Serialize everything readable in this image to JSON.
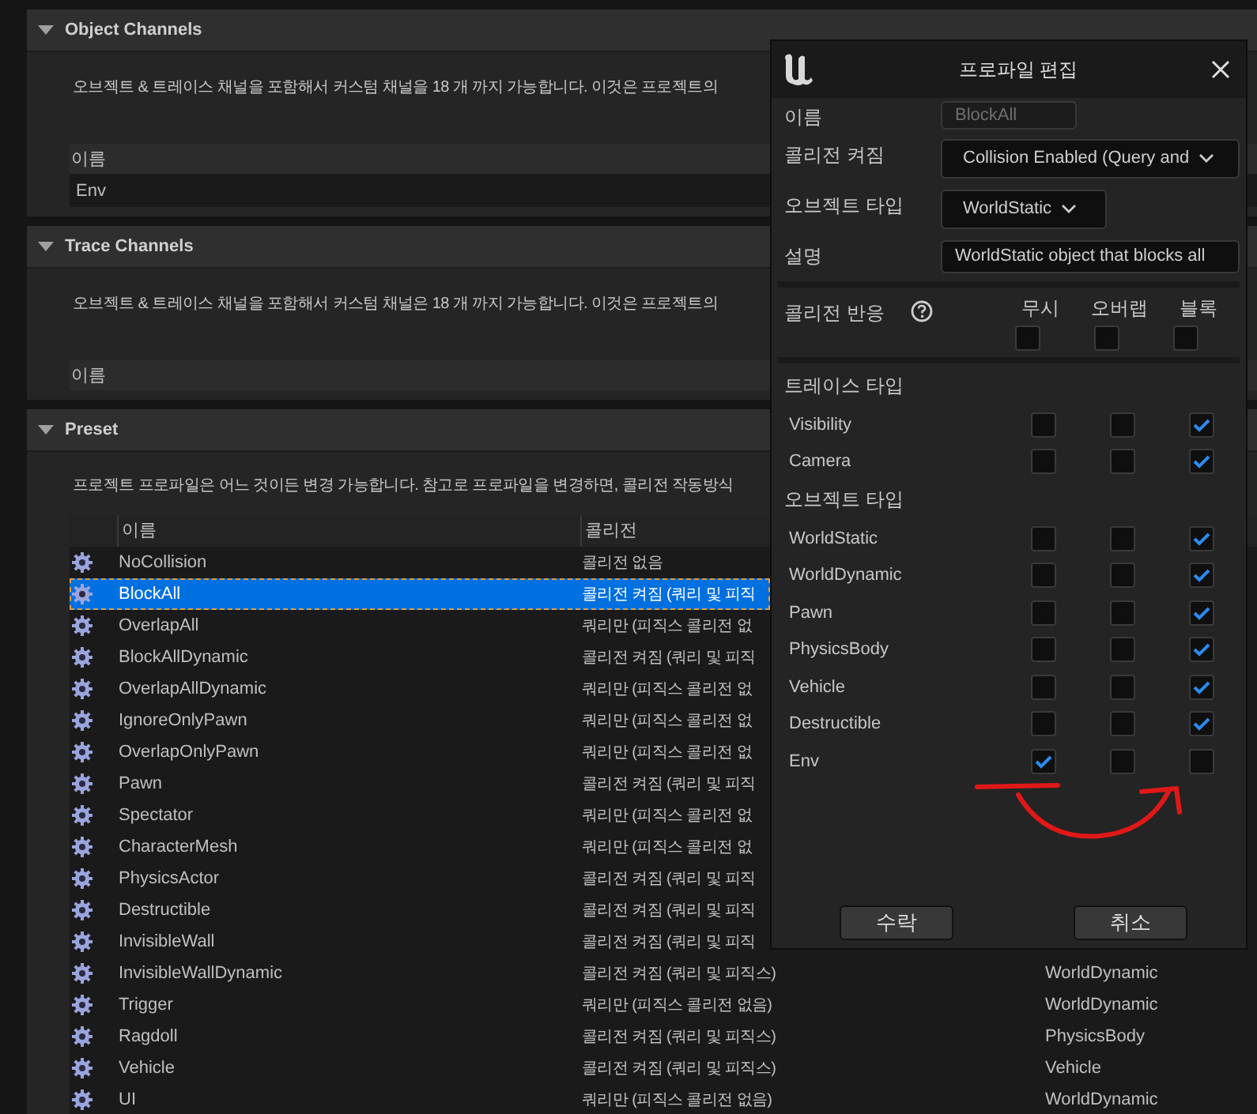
{
  "sections": [
    {
      "title": "Object Channels",
      "expanded": true,
      "description": "오브젝트 & 트레이스 채널을 포함해서 커스텀 채널을 18 개 까지 가능합니다. 이것은 프로젝트의",
      "columns": [
        "이름"
      ],
      "rows": [
        {
          "cells": [
            "Env"
          ],
          "selected": false
        }
      ]
    },
    {
      "title": "Trace Channels",
      "expanded": true,
      "description": "오브젝트 & 트레이스 채널을 포함해서 커스텀 채널은 18 개 까지 가능합니다. 이것은 프로젝트의",
      "columns": [
        "이름"
      ]
    },
    {
      "title": "Preset",
      "expanded": true,
      "description": "프로젝트 프로파일은 어느 것이든 변경 가능합니다. 참고로 프로파일을 변경하면, 콜리전 작동방식",
      "columns": [
        "이름",
        "콜리전"
      ],
      "rows": [
        {
          "cells": [
            "NoCollision",
            "콜리전 없음"
          ],
          "selected": false
        },
        {
          "cells": [
            "BlockAll",
            "콜리전 켜짐 (쿼리 및 피직"
          ],
          "selected": true
        },
        {
          "cells": [
            "OverlapAll",
            "쿼리만 (피직스 콜리전 없"
          ],
          "selected": false
        },
        {
          "cells": [
            "BlockAllDynamic",
            "콜리전 켜짐 (쿼리 및 피직"
          ],
          "selected": false
        },
        {
          "cells": [
            "OverlapAllDynamic",
            "쿼리만 (피직스 콜리전 없"
          ],
          "selected": false
        },
        {
          "cells": [
            "IgnoreOnlyPawn",
            "쿼리만 (피직스 콜리전 없"
          ],
          "selected": false
        },
        {
          "cells": [
            "OverlapOnlyPawn",
            "쿼리만 (피직스 콜리전 없"
          ],
          "selected": false
        },
        {
          "cells": [
            "Pawn",
            "콜리전 켜짐 (쿼리 및 피직"
          ],
          "selected": false
        },
        {
          "cells": [
            "Spectator",
            "쿼리만 (피직스 콜리전 없"
          ],
          "selected": false
        },
        {
          "cells": [
            "CharacterMesh",
            "쿼리만 (피직스 콜리전 없"
          ],
          "selected": false
        },
        {
          "cells": [
            "PhysicsActor",
            "콜리전 켜짐 (쿼리 및 피직"
          ],
          "selected": false
        },
        {
          "cells": [
            "Destructible",
            "콜리전 켜짐 (쿼리 및 피직"
          ],
          "selected": false
        },
        {
          "cells": [
            "InvisibleWall",
            "콜리전 켜짐 (쿼리 및 피직"
          ],
          "selected": false
        },
        {
          "cells": [
            "InvisibleWallDynamic",
            "콜리전 켜짐 (쿼리 및 피직스)",
            "WorldDynamic"
          ],
          "selected": false
        },
        {
          "cells": [
            "Trigger",
            "쿼리만 (피직스 콜리전 없음)",
            "WorldDynamic"
          ],
          "selected": false
        },
        {
          "cells": [
            "Ragdoll",
            "콜리전 켜짐 (쿼리 및 피직스)",
            "PhysicsBody"
          ],
          "selected": false
        },
        {
          "cells": [
            "Vehicle",
            "콜리전 켜짐 (쿼리 및 피직스)",
            "Vehicle"
          ],
          "selected": false
        },
        {
          "cells": [
            "UI",
            "쿼리만 (피직스 콜리전 없음)",
            "WorldDynamic"
          ],
          "selected": false
        }
      ]
    }
  ],
  "dialog": {
    "title": "프로파일 편집",
    "fields": [
      {
        "label": "이름",
        "value": "BlockAll",
        "kind": "readonly"
      },
      {
        "label": "콜리전 켜짐",
        "value": "Collision Enabled (Query and",
        "kind": "dropdown"
      },
      {
        "label": "오브젝트 타입",
        "value": "WorldStatic",
        "kind": "dropdown"
      },
      {
        "label": "설명",
        "value": "WorldStatic object that blocks all",
        "kind": "text"
      }
    ],
    "response": {
      "label": "콜리전 반응",
      "columns": [
        "무시",
        "오버랩",
        "블록"
      ],
      "checks": [
        false,
        false,
        false
      ]
    },
    "groups": [
      {
        "title": "트레이스 타입",
        "rows": [
          {
            "name": "Visibility",
            "checks": [
              false,
              false,
              true
            ]
          },
          {
            "name": "Camera",
            "checks": [
              false,
              false,
              true
            ]
          }
        ]
      },
      {
        "title": "오브젝트 타입",
        "rows": [
          {
            "name": "WorldStatic",
            "checks": [
              false,
              false,
              true
            ]
          },
          {
            "name": "WorldDynamic",
            "checks": [
              false,
              false,
              true
            ]
          },
          {
            "name": "Pawn",
            "checks": [
              false,
              false,
              true
            ]
          },
          {
            "name": "PhysicsBody",
            "checks": [
              false,
              false,
              true
            ]
          },
          {
            "name": "Vehicle",
            "checks": [
              false,
              false,
              true
            ]
          },
          {
            "name": "Destructible",
            "checks": [
              false,
              false,
              true
            ]
          },
          {
            "name": "Env",
            "checks": [
              true,
              false,
              false
            ]
          }
        ]
      }
    ],
    "buttons": [
      "수락",
      "취소"
    ]
  }
}
